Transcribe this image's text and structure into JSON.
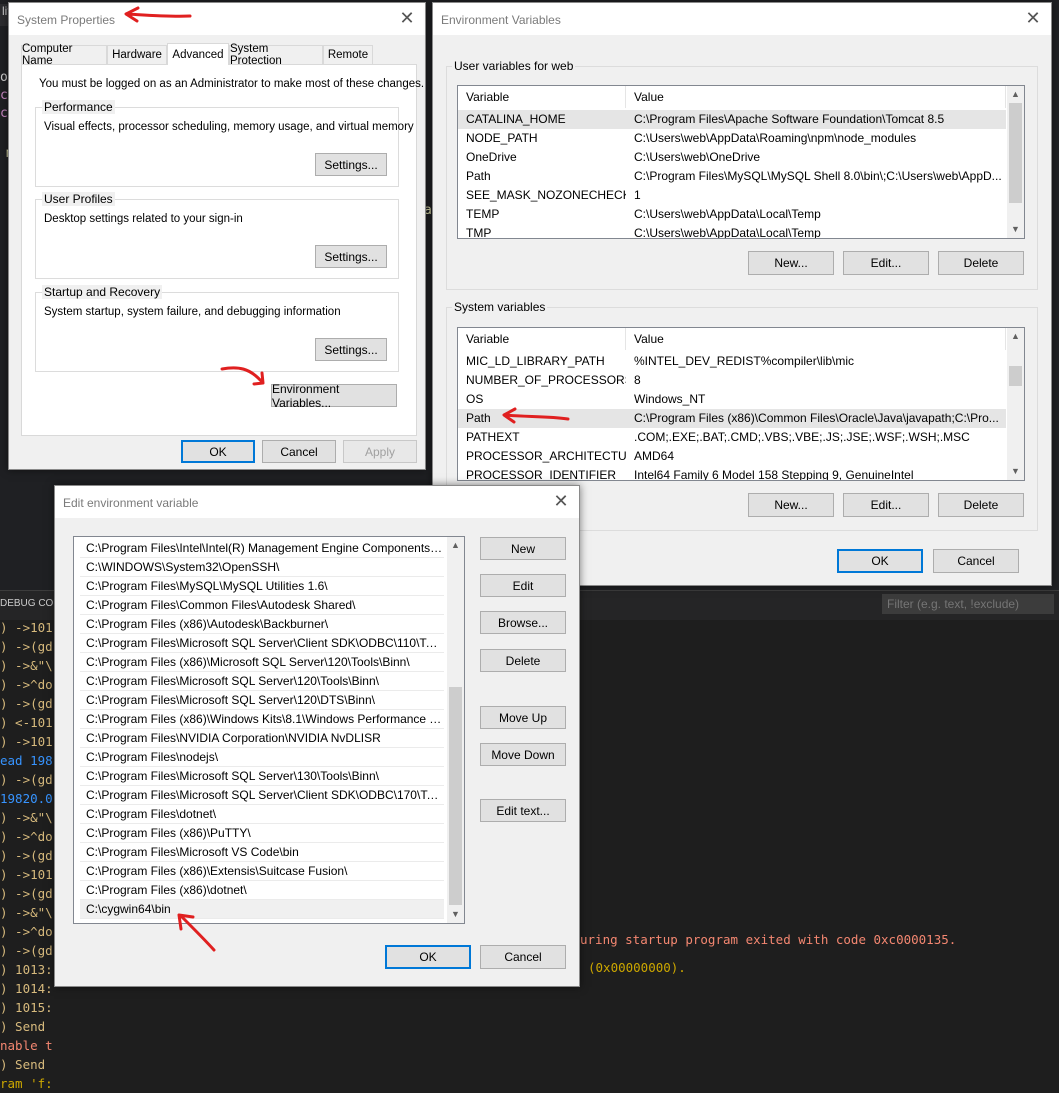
{
  "background": {
    "editor_tab": "lit",
    "debug_label": "DEBUG CONS",
    "filter_placeholder": "Filter (e.g. text, !exclude)",
    "editor_fragments": [
      "op",
      "cl",
      "cl",
      "m",
      "/",
      "c",
      "/",
      "p",
      "i",
      "i",
      "i",
      "/",
      "p",
      "a",
      "n"
    ],
    "terminal_lines": [
      ") ->101",
      ") ->(gd",
      ") ->&\"\\",
      ") ->^do",
      ") ->(gd",
      ") <-101",
      ") ->101",
      "ead 198",
      ") ->(gd",
      "19820.0",
      ") ->&\"\\",
      ") ->^do",
      ") ->(gd",
      ") ->101",
      ") ->(gd",
      ") ->&\"\\",
      ") ->^do",
      ") ->(gd",
      ") 1013:",
      ") 1014:",
      ") 1015:",
      ") Send",
      "nable t",
      ") Send",
      "ram 'f:"
    ],
    "terminal_right_1": "uring startup program exited with code 0xc0000135.",
    "terminal_right_2": "(0x00000000)."
  },
  "system_properties": {
    "title": "System Properties",
    "tabs": [
      "Computer Name",
      "Hardware",
      "Advanced",
      "System Protection",
      "Remote"
    ],
    "active_tab": "Advanced",
    "admin_note": "You must be logged on as an Administrator to make most of these changes.",
    "performance": {
      "label": "Performance",
      "desc": "Visual effects, processor scheduling, memory usage, and virtual memory",
      "button": "Settings..."
    },
    "user_profiles": {
      "label": "User Profiles",
      "desc": "Desktop settings related to your sign-in",
      "button": "Settings..."
    },
    "startup_recovery": {
      "label": "Startup and Recovery",
      "desc": "System startup, system failure, and debugging information",
      "button": "Settings..."
    },
    "env_button": "Environment Variables...",
    "ok": "OK",
    "cancel": "Cancel",
    "apply": "Apply"
  },
  "environment_variables": {
    "title": "Environment Variables",
    "user_group_label": "User variables for web",
    "columns": [
      "Variable",
      "Value"
    ],
    "user_vars": [
      [
        "CATALINA_HOME",
        "C:\\Program Files\\Apache Software Foundation\\Tomcat 8.5"
      ],
      [
        "NODE_PATH",
        "C:\\Users\\web\\AppData\\Roaming\\npm\\node_modules"
      ],
      [
        "OneDrive",
        "C:\\Users\\web\\OneDrive"
      ],
      [
        "Path",
        "C:\\Program Files\\MySQL\\MySQL Shell 8.0\\bin\\;C:\\Users\\web\\AppD..."
      ],
      [
        "SEE_MASK_NOZONECHECKS",
        "1"
      ],
      [
        "TEMP",
        "C:\\Users\\web\\AppData\\Local\\Temp"
      ],
      [
        "TMP",
        "C:\\Users\\web\\AppData\\Local\\Temp"
      ]
    ],
    "user_buttons": [
      "New...",
      "Edit...",
      "Delete"
    ],
    "system_group_label": "System variables",
    "system_vars": [
      [
        "MIC_LD_LIBRARY_PATH",
        "%INTEL_DEV_REDIST%compiler\\lib\\mic"
      ],
      [
        "NUMBER_OF_PROCESSORS",
        "8"
      ],
      [
        "OS",
        "Windows_NT"
      ],
      [
        "Path",
        "C:\\Program Files (x86)\\Common Files\\Oracle\\Java\\javapath;C:\\Pro..."
      ],
      [
        "PATHEXT",
        ".COM;.EXE;.BAT;.CMD;.VBS;.VBE;.JS;.JSE;.WSF;.WSH;.MSC"
      ],
      [
        "PROCESSOR_ARCHITECTURE",
        "AMD64"
      ],
      [
        "PROCESSOR_IDENTIFIER",
        "Intel64 Family 6 Model 158 Stepping 9, GenuineIntel"
      ]
    ],
    "system_buttons": [
      "New...",
      "Edit...",
      "Delete"
    ],
    "ok": "OK",
    "cancel": "Cancel"
  },
  "edit_env_var": {
    "title": "Edit environment variable",
    "entries": [
      "C:\\Program Files\\Intel\\Intel(R) Management Engine Components\\I...",
      "C:\\WINDOWS\\System32\\OpenSSH\\",
      "C:\\Program Files\\MySQL\\MySQL Utilities 1.6\\",
      "C:\\Program Files\\Common Files\\Autodesk Shared\\",
      "C:\\Program Files (x86)\\Autodesk\\Backburner\\",
      "C:\\Program Files\\Microsoft SQL Server\\Client SDK\\ODBC\\110\\Tool...",
      "C:\\Program Files (x86)\\Microsoft SQL Server\\120\\Tools\\Binn\\",
      "C:\\Program Files\\Microsoft SQL Server\\120\\Tools\\Binn\\",
      "C:\\Program Files\\Microsoft SQL Server\\120\\DTS\\Binn\\",
      "C:\\Program Files (x86)\\Windows Kits\\8.1\\Windows Performance To...",
      "C:\\Program Files\\NVIDIA Corporation\\NVIDIA NvDLISR",
      "C:\\Program Files\\nodejs\\",
      "C:\\Program Files\\Microsoft SQL Server\\130\\Tools\\Binn\\",
      "C:\\Program Files\\Microsoft SQL Server\\Client SDK\\ODBC\\170\\Tool...",
      "C:\\Program Files\\dotnet\\",
      "C:\\Program Files (x86)\\PuTTY\\",
      "C:\\Program Files\\Microsoft VS Code\\bin",
      "C:\\Program Files (x86)\\Extensis\\Suitcase Fusion\\",
      "C:\\Program Files (x86)\\dotnet\\",
      "C:\\cygwin64\\bin"
    ],
    "buttons": {
      "new": "New",
      "edit": "Edit",
      "browse": "Browse...",
      "delete": "Delete",
      "move_up": "Move Up",
      "move_down": "Move Down",
      "edit_text": "Edit text..."
    },
    "ok": "OK",
    "cancel": "Cancel"
  },
  "annotations": {
    "arrow_color": "#e02020"
  }
}
